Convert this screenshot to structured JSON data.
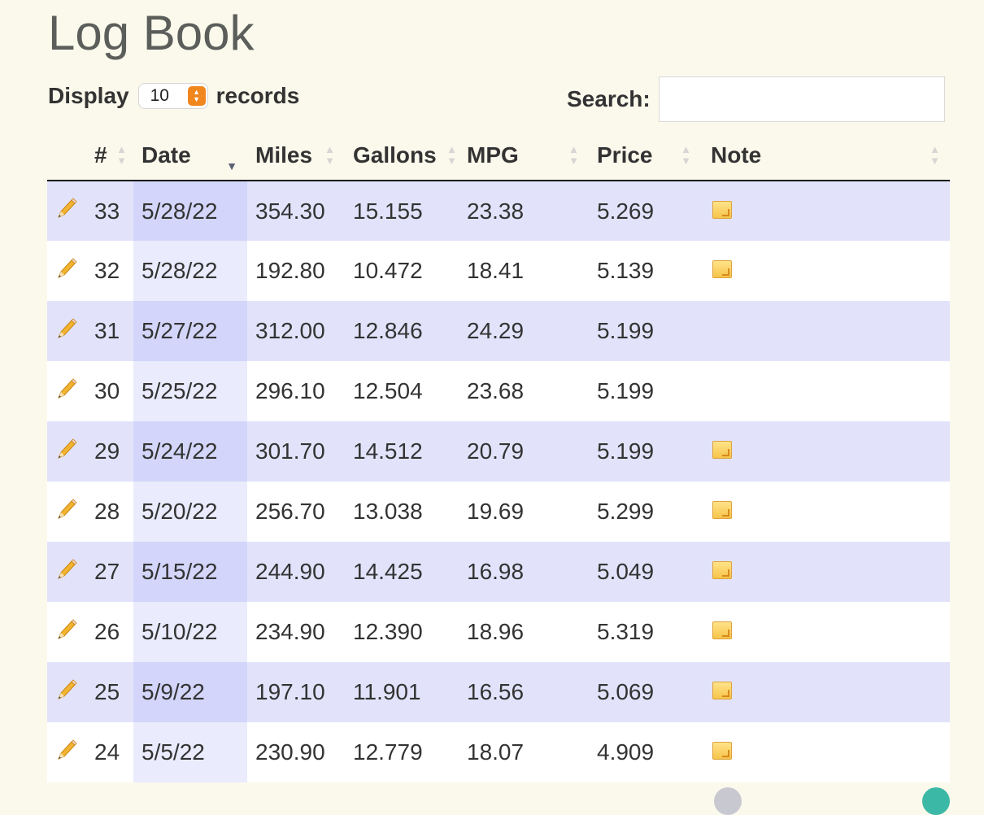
{
  "page": {
    "title": "Log Book"
  },
  "controls": {
    "length_prefix": "Display",
    "length_value": "10",
    "length_suffix": "records",
    "search_label": "Search:",
    "search_value": ""
  },
  "table": {
    "columns": [
      "",
      "#",
      "Date",
      "Miles",
      "Gallons",
      "MPG",
      "Price",
      "Note"
    ],
    "sorted_column": "Date",
    "sort_direction": "descending",
    "rows": [
      {
        "num": "33",
        "date": "5/28/22",
        "miles": "354.30",
        "gallons": "15.155",
        "mpg": "23.38",
        "price": "5.269",
        "has_note": true
      },
      {
        "num": "32",
        "date": "5/28/22",
        "miles": "192.80",
        "gallons": "10.472",
        "mpg": "18.41",
        "price": "5.139",
        "has_note": true
      },
      {
        "num": "31",
        "date": "5/27/22",
        "miles": "312.00",
        "gallons": "12.846",
        "mpg": "24.29",
        "price": "5.199",
        "has_note": false
      },
      {
        "num": "30",
        "date": "5/25/22",
        "miles": "296.10",
        "gallons": "12.504",
        "mpg": "23.68",
        "price": "5.199",
        "has_note": false
      },
      {
        "num": "29",
        "date": "5/24/22",
        "miles": "301.70",
        "gallons": "14.512",
        "mpg": "20.79",
        "price": "5.199",
        "has_note": true
      },
      {
        "num": "28",
        "date": "5/20/22",
        "miles": "256.70",
        "gallons": "13.038",
        "mpg": "19.69",
        "price": "5.299",
        "has_note": true
      },
      {
        "num": "27",
        "date": "5/15/22",
        "miles": "244.90",
        "gallons": "14.425",
        "mpg": "16.98",
        "price": "5.049",
        "has_note": true
      },
      {
        "num": "26",
        "date": "5/10/22",
        "miles": "234.90",
        "gallons": "12.390",
        "mpg": "18.96",
        "price": "5.319",
        "has_note": true
      },
      {
        "num": "25",
        "date": "5/9/22",
        "miles": "197.10",
        "gallons": "11.901",
        "mpg": "16.56",
        "price": "5.069",
        "has_note": true
      },
      {
        "num": "24",
        "date": "5/5/22",
        "miles": "230.90",
        "gallons": "12.779",
        "mpg": "18.07",
        "price": "4.909",
        "has_note": true
      }
    ]
  },
  "icons": {
    "edit": "pencil-icon",
    "note": "note-icon"
  },
  "colors": {
    "background": "#fbf9ec",
    "row_odd": "#e2e3fb",
    "row_even": "#ffffff",
    "sorted_odd": "#d3d6fa",
    "sorted_even": "#eaebfc",
    "select_accent": "#f0861c",
    "title": "#5b5e5a"
  }
}
